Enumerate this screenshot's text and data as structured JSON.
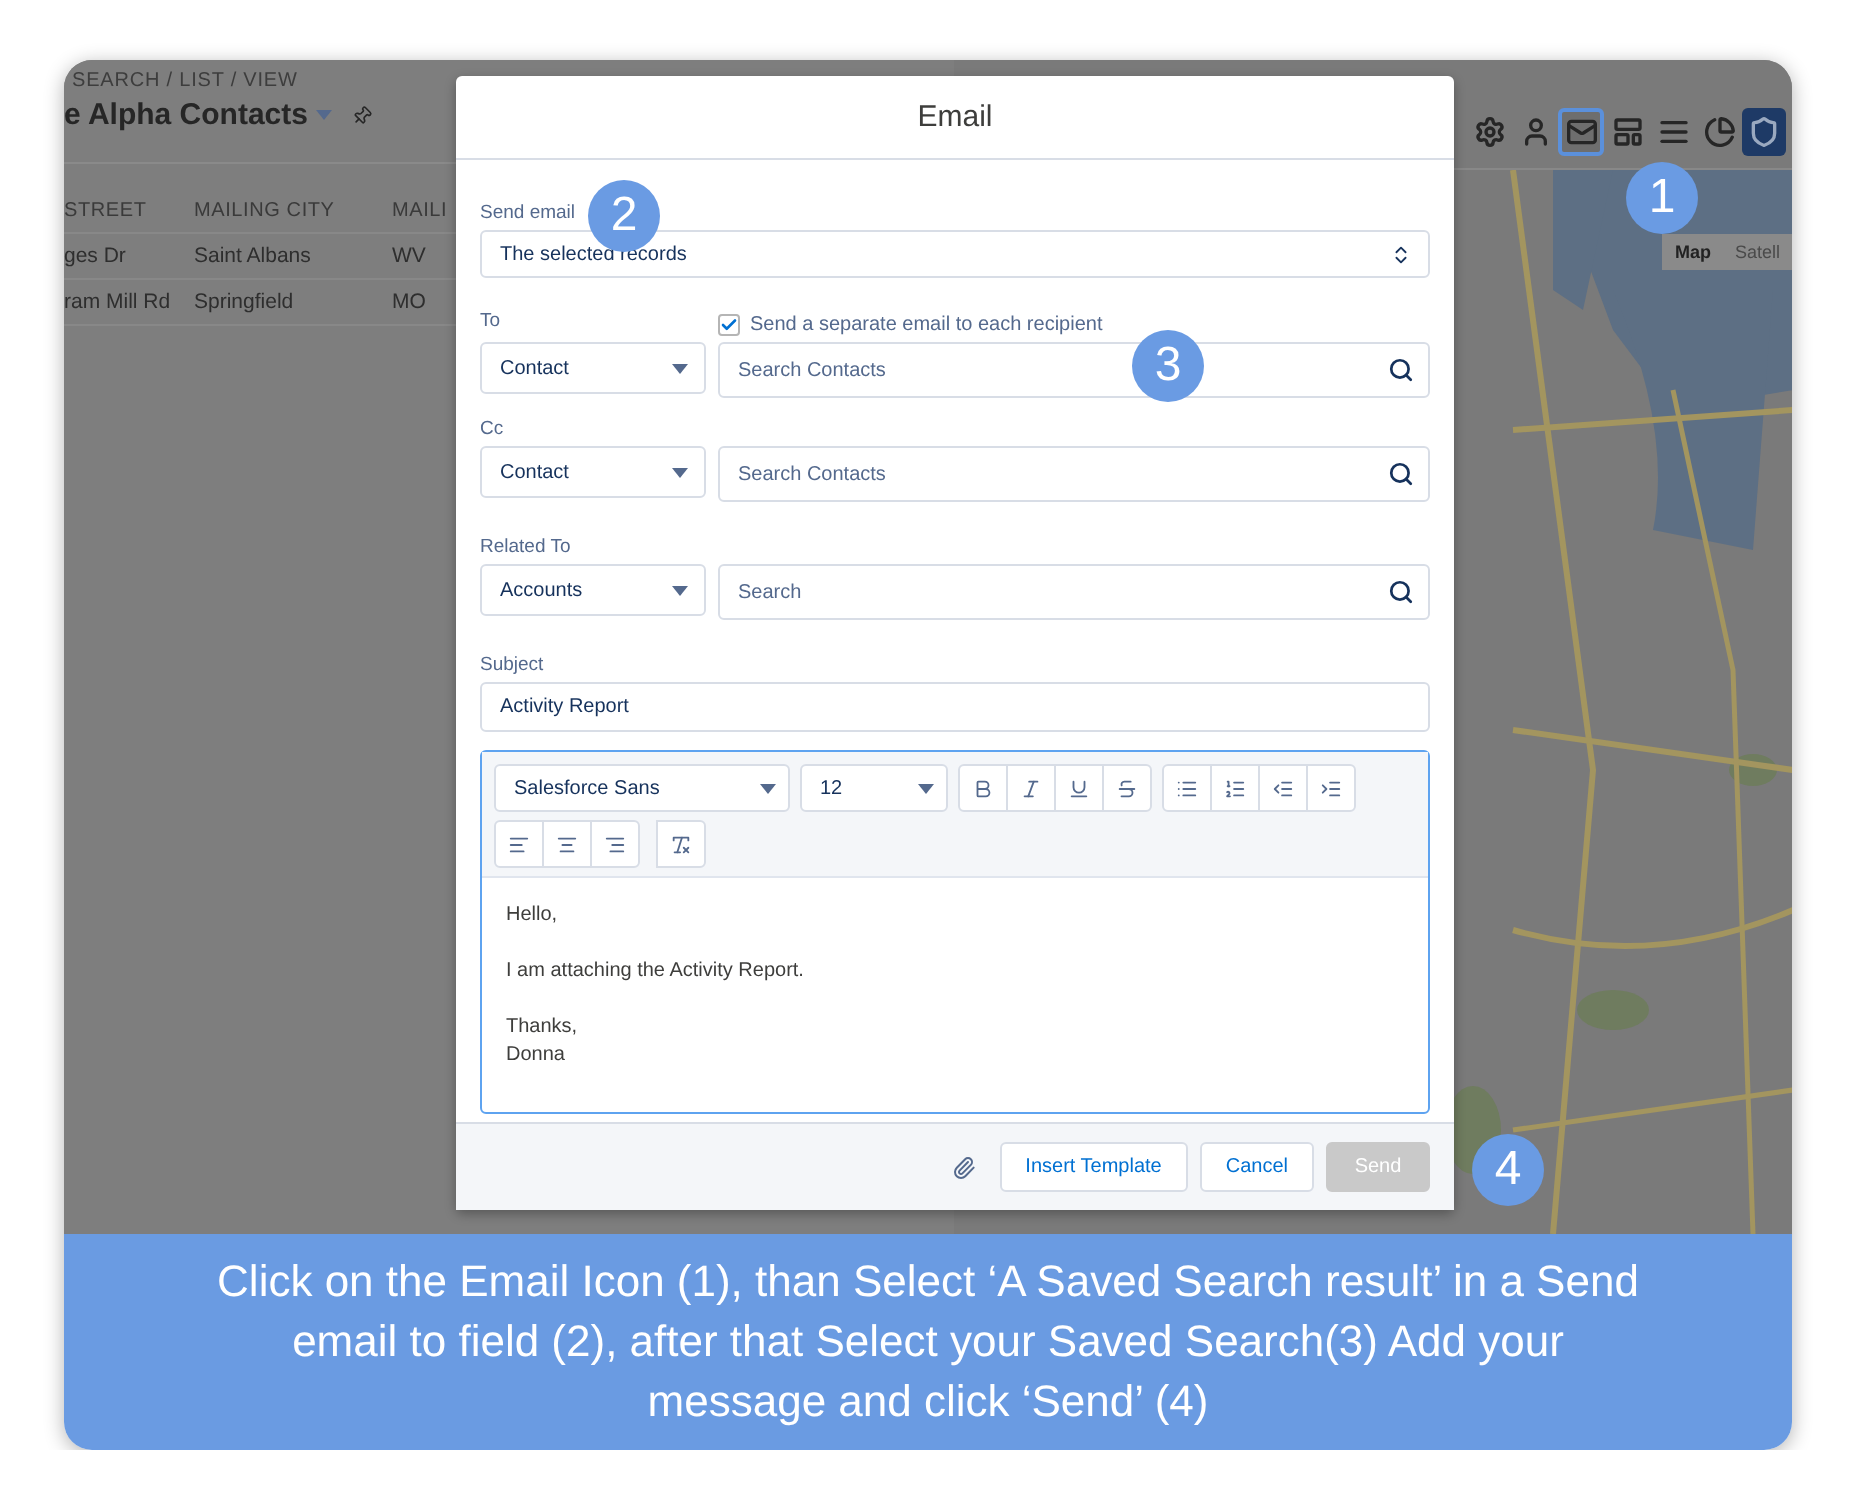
{
  "app": {
    "breadcrumb": "SEARCH / LIST / VIEW",
    "list_title": "e Alpha Contacts",
    "table": {
      "columns": [
        "STREET",
        "MAILING CITY",
        "MAILI"
      ],
      "rows": [
        [
          "ges Dr",
          "Saint Albans",
          "WV"
        ],
        [
          "ram Mill Rd",
          "Springfield",
          "MO"
        ]
      ]
    },
    "toolbar": [
      {
        "kind": "settings",
        "selected": false
      },
      {
        "kind": "user",
        "selected": false
      },
      {
        "kind": "email",
        "selected": true
      },
      {
        "kind": "layout",
        "selected": false
      },
      {
        "kind": "list",
        "selected": false
      },
      {
        "kind": "chart",
        "selected": false
      },
      {
        "kind": "shield",
        "selected": false
      }
    ],
    "map_type_buttons": [
      {
        "label": "Map",
        "selected": true
      },
      {
        "label": "Satell",
        "selected": false
      }
    ]
  },
  "dialog": {
    "title": "Email",
    "send_email": {
      "label": "Send email",
      "value": "The selected records"
    },
    "to": {
      "label": "To",
      "type": "Contact",
      "placeholder": "Search Contacts"
    },
    "separate_email": {
      "label": "Send a separate email to each recipient",
      "checked": true
    },
    "cc": {
      "label": "Cc",
      "type": "Contact",
      "placeholder": "Search Contacts"
    },
    "related_to": {
      "label": "Related To",
      "type": "Accounts",
      "placeholder": "Search"
    },
    "subject": {
      "label": "Subject",
      "value": "Activity Report"
    },
    "editor": {
      "font": "Salesforce Sans",
      "size": "12",
      "body": [
        "Hello,",
        "I am attaching the Activity Report.",
        "Thanks,\nDonna"
      ]
    },
    "buttons": [
      {
        "kind": "outline",
        "label": "Insert Template"
      },
      {
        "kind": "outline",
        "label": "Cancel"
      },
      {
        "kind": "primary",
        "label": "Send",
        "disabled": true
      }
    ]
  },
  "badges": [
    "1",
    "2",
    "3",
    "4"
  ],
  "caption": "Click on the Email Icon (1), than Select ‘A Saved Search result’ in a Send email to field (2), after that Select your Saved Search(3) Add your message and click ‘Send’ (4)"
}
